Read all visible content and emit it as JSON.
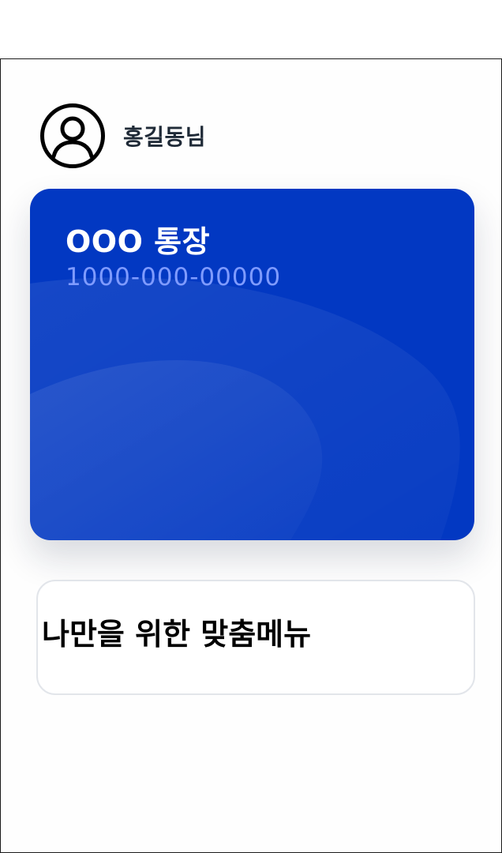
{
  "profile": {
    "avatar_icon": "user-circle-icon",
    "user_name": "홍길동님"
  },
  "account_card": {
    "title": "OOO 통장",
    "account_number": "1000-000-00000",
    "background_color": "#0238C2",
    "number_color": "#7F9BFF"
  },
  "custom_menu": {
    "title": "나만을 위한 맞춤메뉴"
  }
}
